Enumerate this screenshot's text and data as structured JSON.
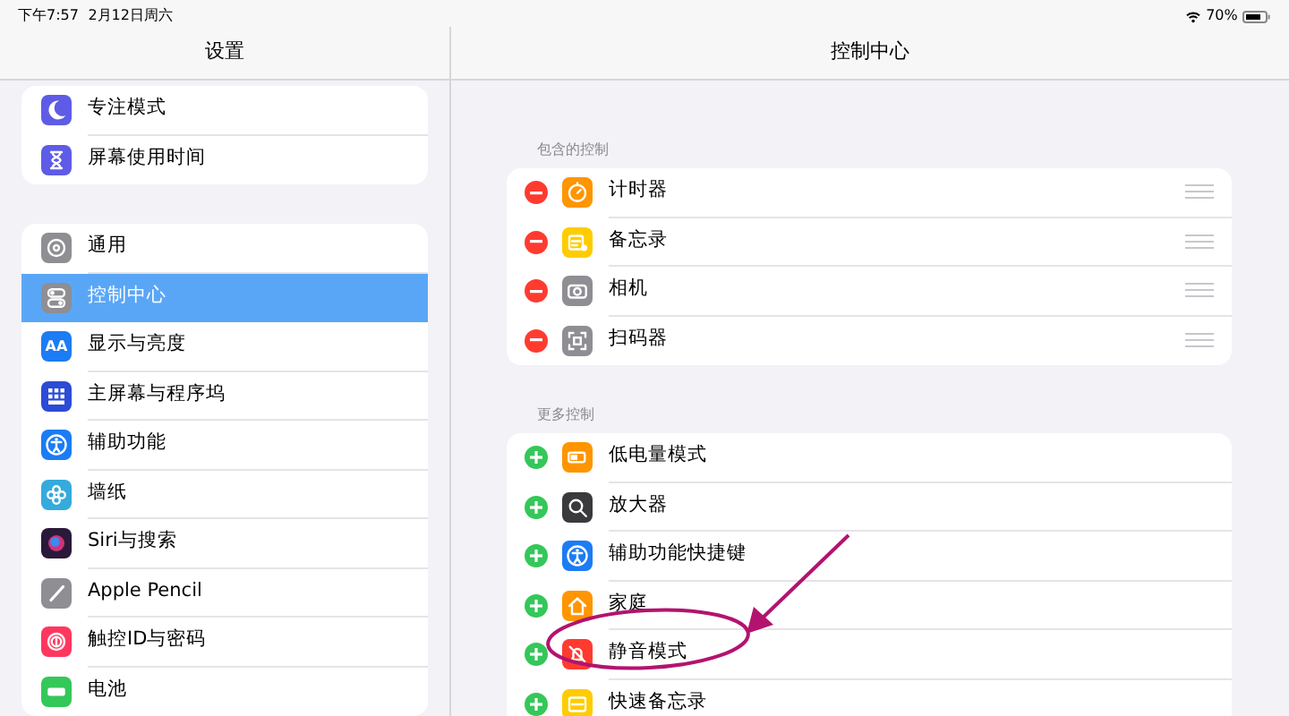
{
  "status_bar": {
    "time": "下午7:57",
    "date": "2月12日周六",
    "battery": "70%"
  },
  "sidebar": {
    "title": "设置",
    "groups": [
      {
        "items": [
          {
            "label": "专注模式",
            "color": "#5e5ce6",
            "selected": false
          },
          {
            "label": "屏幕使用时间",
            "color": "#5e5ce6",
            "selected": false
          }
        ]
      },
      {
        "items": [
          {
            "label": "通用",
            "color": "#8e8e93",
            "selected": false
          },
          {
            "label": "控制中心",
            "color": "#8e8e93",
            "selected": true
          },
          {
            "label": "显示与亮度",
            "color": "#1c7cf4",
            "icon_text": "AA",
            "selected": false
          },
          {
            "label": "主屏幕与程序坞",
            "color": "#2c4bd6",
            "selected": false
          },
          {
            "label": "辅助功能",
            "color": "#1c7cf4",
            "selected": false
          },
          {
            "label": "墙纸",
            "color": "#35aadc",
            "selected": false
          },
          {
            "label": "Siri与搜索",
            "color": "#2a1a3a",
            "selected": false
          },
          {
            "label": "Apple Pencil",
            "color": "#8e8e93",
            "selected": false
          },
          {
            "label": "触控ID与密码",
            "color": "#ff375f",
            "selected": false
          },
          {
            "label": "电池",
            "color": "#34c759",
            "selected": false
          }
        ]
      }
    ]
  },
  "detail": {
    "title": "控制中心",
    "sections": [
      {
        "header": "包含的控制",
        "rows": [
          {
            "kind": "remove",
            "label": "计时器",
            "color": "#ff9500"
          },
          {
            "kind": "remove",
            "label": "备忘录",
            "color": "#ffcc00"
          },
          {
            "kind": "remove",
            "label": "相机",
            "color": "#8e8e93"
          },
          {
            "kind": "remove",
            "label": "扫码器",
            "color": "#8e8e93"
          }
        ]
      },
      {
        "header": "更多控制",
        "rows": [
          {
            "kind": "add",
            "label": "低电量模式",
            "color": "#ff9500"
          },
          {
            "kind": "add",
            "label": "放大器",
            "color": "#3a3a3c"
          },
          {
            "kind": "add",
            "label": "辅助功能快捷键",
            "color": "#1c7cf4"
          },
          {
            "kind": "add",
            "label": "家庭",
            "color": "#ff9500"
          },
          {
            "kind": "add",
            "label": "静音模式",
            "color": "#ff3b30"
          },
          {
            "kind": "add",
            "label": "快速备忘录",
            "color": "#ffcc00"
          }
        ]
      }
    ]
  }
}
